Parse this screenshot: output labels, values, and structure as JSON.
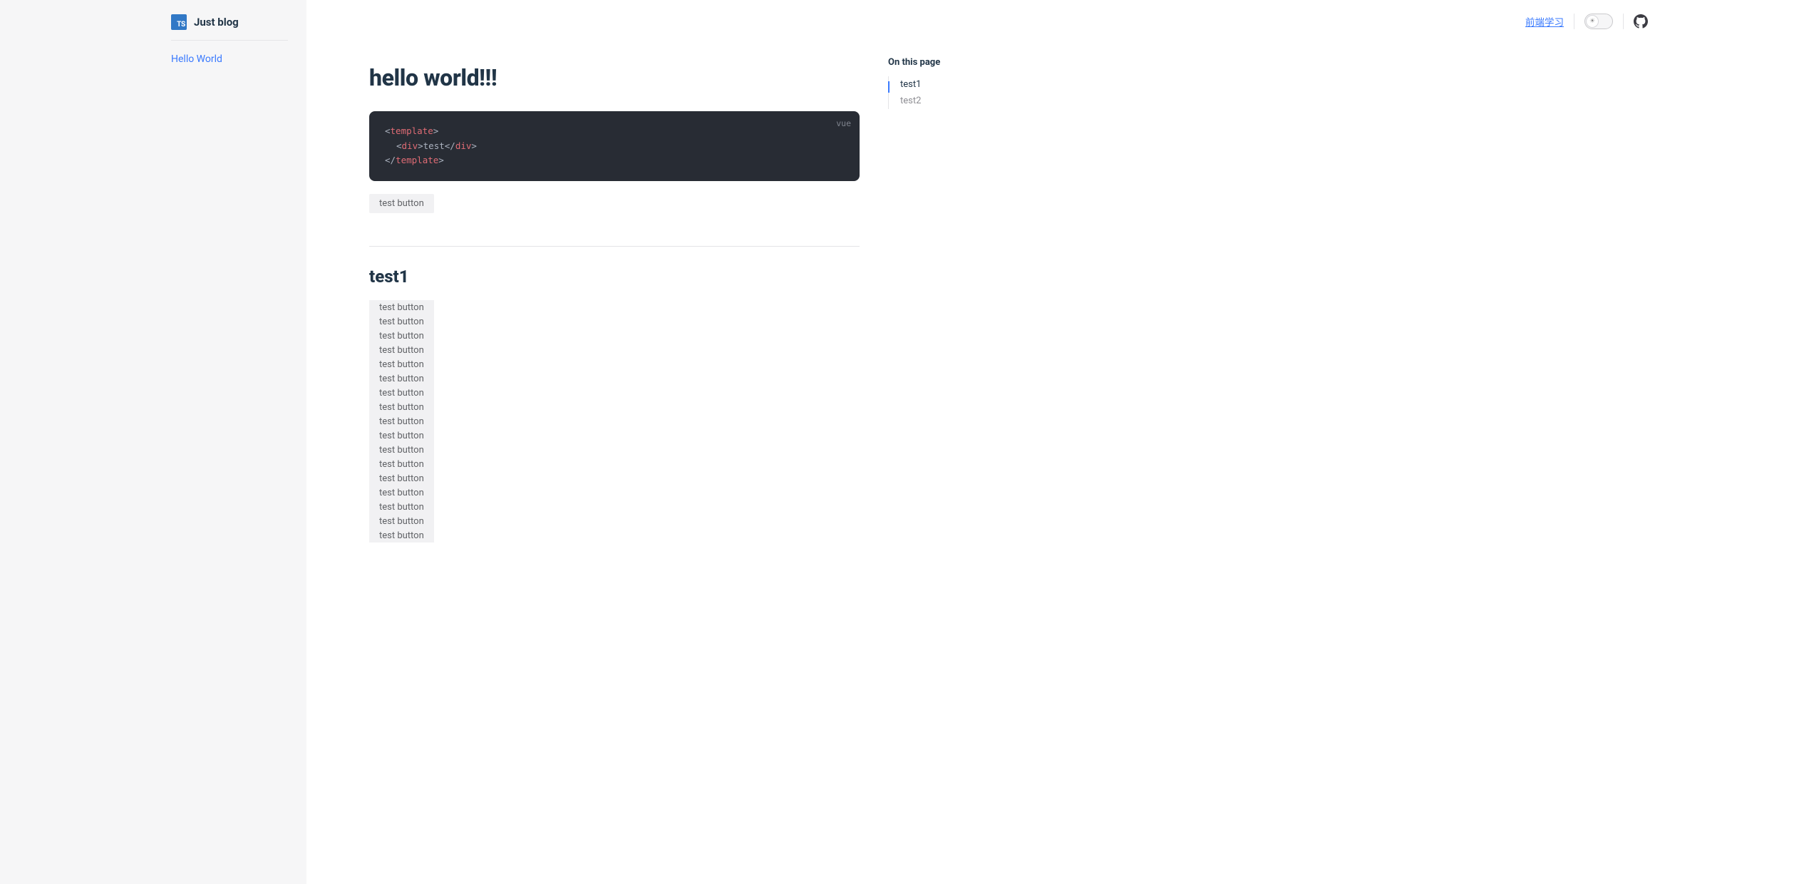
{
  "site": {
    "title": "Just blog",
    "badge": "TS"
  },
  "sidebar": {
    "links": [
      {
        "label": "Hello World"
      }
    ]
  },
  "topbar": {
    "nav_link": "前端学习"
  },
  "article": {
    "title": "hello world!!!",
    "code": {
      "lang": "vue",
      "lines": [
        {
          "indent": 0,
          "parts": [
            {
              "t": "<",
              "k": "angle"
            },
            {
              "t": "template",
              "k": "tag"
            },
            {
              "t": ">",
              "k": "angle"
            }
          ]
        },
        {
          "indent": 1,
          "parts": [
            {
              "t": "<",
              "k": "angle"
            },
            {
              "t": "div",
              "k": "tag"
            },
            {
              "t": ">",
              "k": "angle"
            },
            {
              "t": "test",
              "k": "text"
            },
            {
              "t": "</",
              "k": "angle"
            },
            {
              "t": "div",
              "k": "tag"
            },
            {
              "t": ">",
              "k": "angle"
            }
          ]
        },
        {
          "indent": 0,
          "parts": [
            {
              "t": "</",
              "k": "angle"
            },
            {
              "t": "template",
              "k": "tag"
            },
            {
              "t": ">",
              "k": "angle"
            }
          ]
        }
      ]
    },
    "single_button": "test button",
    "sections": [
      {
        "id": "test1",
        "title": "test1",
        "buttons": [
          "test button",
          "test button",
          "test button",
          "test button",
          "test button",
          "test button",
          "test button",
          "test button",
          "test button",
          "test button",
          "test button",
          "test button",
          "test button",
          "test button",
          "test button",
          "test button",
          "test button"
        ]
      }
    ]
  },
  "toc": {
    "heading": "On this page",
    "items": [
      {
        "label": "test1",
        "active": true
      },
      {
        "label": "test2",
        "active": false
      }
    ]
  }
}
